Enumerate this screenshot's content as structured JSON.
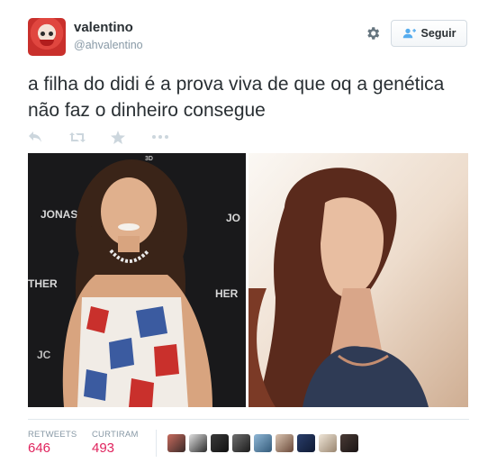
{
  "user": {
    "name": "valentino",
    "handle": "@ahvalentino"
  },
  "follow_button": {
    "label": "Seguir"
  },
  "tweet": {
    "text": "a filha do didi é a prova viva de que oq a genética não faz o dinheiro consegue"
  },
  "photos": {
    "left_backdrop": [
      "JONAS",
      "JO",
      "THER",
      "HER",
      "3D",
      "JC"
    ]
  },
  "stats": {
    "retweets_label": "RETWEETS",
    "retweets": "646",
    "likes_label": "CURTIRAM",
    "likes": "493"
  },
  "icons": [
    "avatar",
    "gear-icon",
    "add-user-icon",
    "reply-icon",
    "retweet-icon",
    "favorite-icon",
    "more-icon"
  ],
  "colors": {
    "text": "#292f33",
    "muted": "#8899a6",
    "stat": "#e0245e",
    "follow_icon": "#55acee"
  }
}
